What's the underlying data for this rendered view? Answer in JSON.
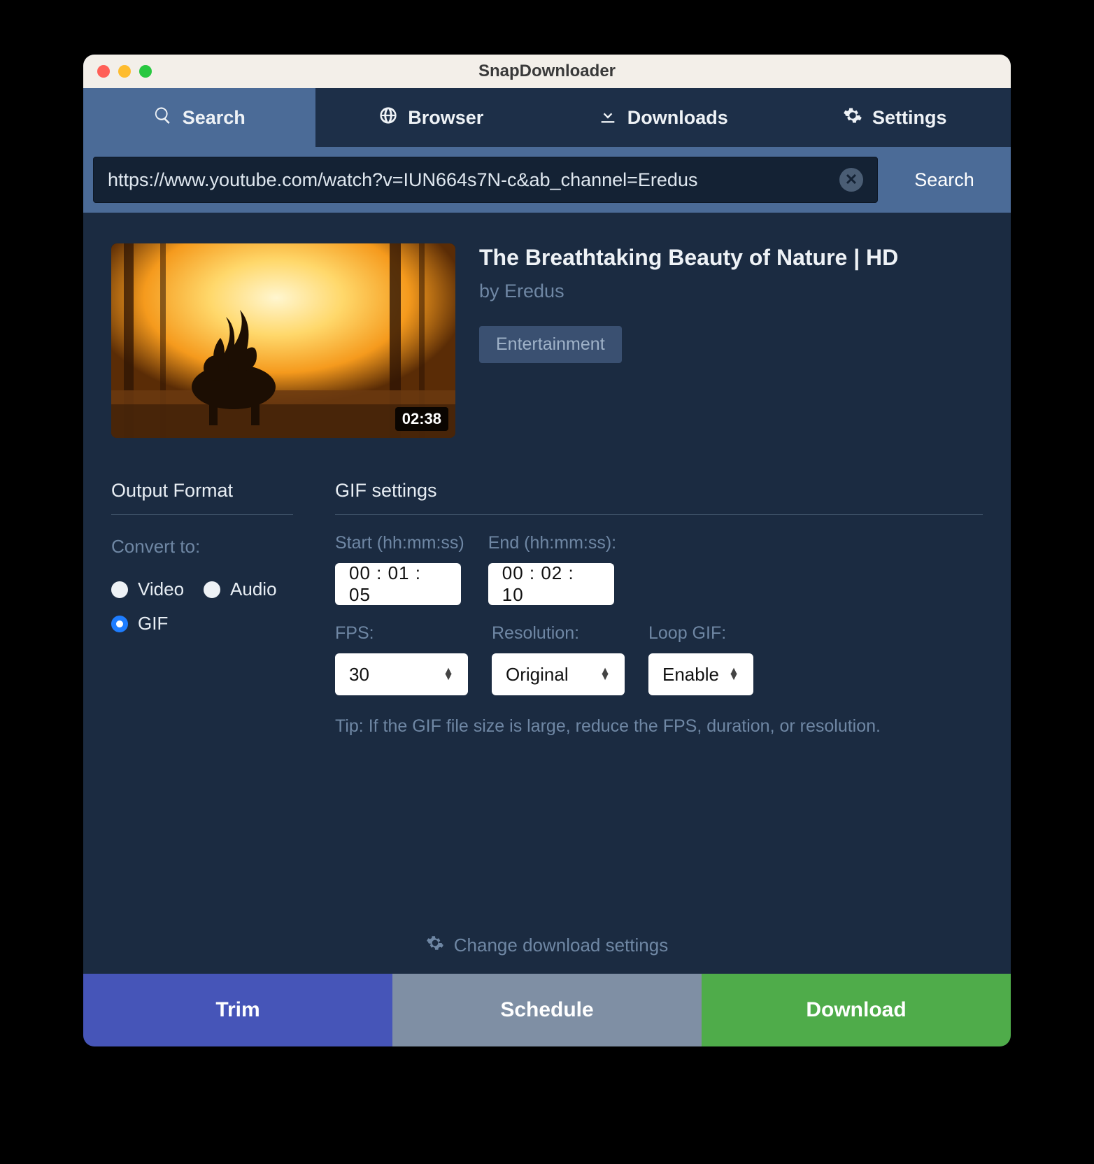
{
  "titlebar": {
    "title": "SnapDownloader"
  },
  "tabs": {
    "search": "Search",
    "browser": "Browser",
    "downloads": "Downloads",
    "settings": "Settings"
  },
  "urlbar": {
    "value": "https://www.youtube.com/watch?v=IUN664s7N-c&ab_channel=Eredus",
    "search_label": "Search"
  },
  "video": {
    "title": "The Breathtaking Beauty of Nature | HD",
    "by": "by Eredus",
    "category": "Entertainment",
    "duration": "02:38"
  },
  "output_format": {
    "section_title": "Output Format",
    "convert_to_label": "Convert to:",
    "options": {
      "video": "Video",
      "audio": "Audio",
      "gif": "GIF"
    },
    "selected": "gif"
  },
  "gif_settings": {
    "section_title": "GIF settings",
    "start_label": "Start (hh:mm:ss)",
    "end_label": "End (hh:mm:ss):",
    "start_value": "00 : 01 : 05",
    "end_value": "00 : 02 : 10",
    "fps_label": "FPS:",
    "fps_value": "30",
    "resolution_label": "Resolution:",
    "resolution_value": "Original",
    "loop_label": "Loop GIF:",
    "loop_value": "Enable",
    "tip": "Tip: If the GIF file size is large, reduce the FPS, duration, or resolution."
  },
  "change_settings_label": "Change download settings",
  "footer": {
    "trim": "Trim",
    "schedule": "Schedule",
    "download": "Download"
  }
}
